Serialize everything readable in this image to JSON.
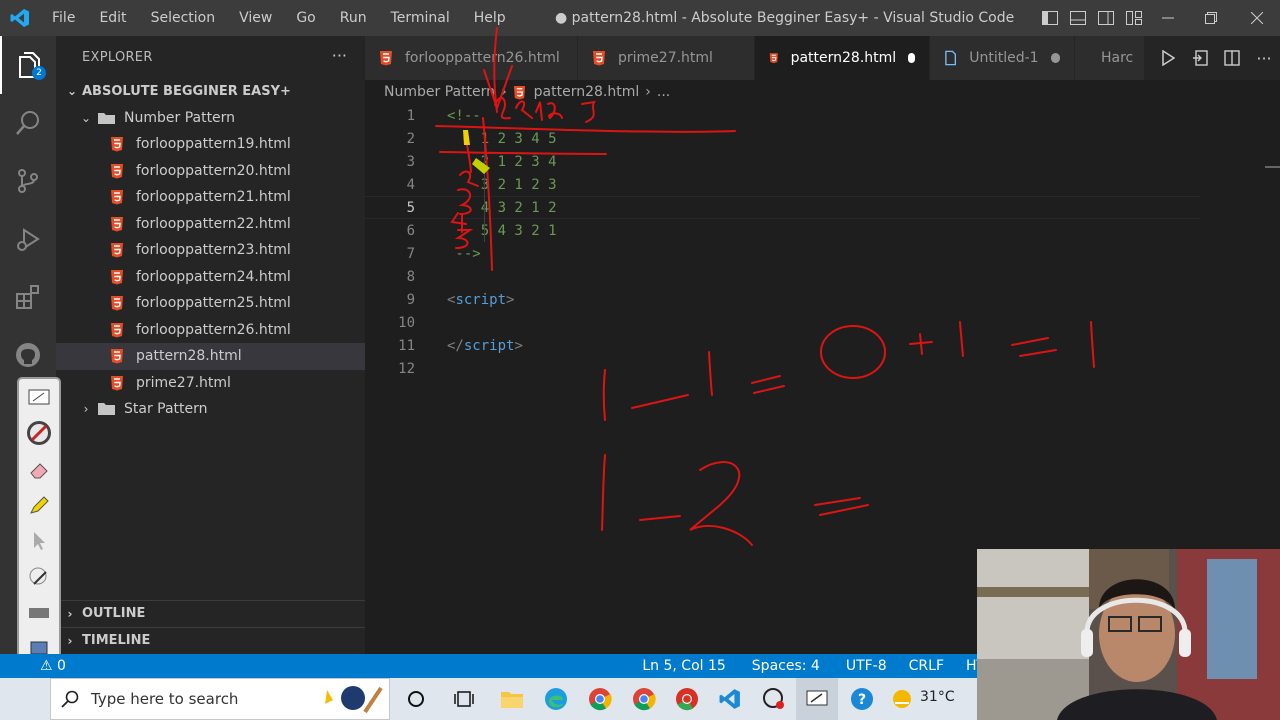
{
  "window": {
    "title": "● pattern28.html - Absolute Begginer Easy+ - Visual Studio Code",
    "menu": [
      "File",
      "Edit",
      "Selection",
      "View",
      "Go",
      "Run",
      "Terminal",
      "Help"
    ]
  },
  "activity_bar": {
    "explorer_badge": "2"
  },
  "sidebar": {
    "header": "EXPLORER",
    "root_folder": "ABSOLUTE BEGGINER EASY+",
    "folder_number_pattern": "Number Pattern",
    "files": [
      "forlooppattern19.html",
      "forlooppattern20.html",
      "forlooppattern21.html",
      "forlooppattern22.html",
      "forlooppattern23.html",
      "forlooppattern24.html",
      "forlooppattern25.html",
      "forlooppattern26.html",
      "pattern28.html",
      "prime27.html"
    ],
    "selected_file": "pattern28.html",
    "folder_star_pattern": "Star Pattern",
    "outline": "OUTLINE",
    "timeline": "TIMELINE"
  },
  "tabs": [
    {
      "label": "forlooppattern26.html",
      "active": false,
      "dirty": false
    },
    {
      "label": "prime27.html",
      "active": false,
      "dirty": false
    },
    {
      "label": "pattern28.html",
      "active": true,
      "dirty": true
    },
    {
      "label": "Untitled-1",
      "active": false,
      "dirty": true
    },
    {
      "label": "Harc",
      "active": false,
      "dirty": false
    }
  ],
  "breadcrumb": {
    "folder": "Number Pattern",
    "file": "pattern28.html",
    "tail": "..."
  },
  "editor": {
    "current_line": 5,
    "lines": [
      {
        "n": "1",
        "text": "<!--"
      },
      {
        "n": "2",
        "text": "    1 2 3 4 5"
      },
      {
        "n": "3",
        "text": "    2 1 2 3 4"
      },
      {
        "n": "4",
        "text": "    3 2 1 2 3"
      },
      {
        "n": "5",
        "text": "    4 3 2 1 2"
      },
      {
        "n": "6",
        "text": "    5 4 3 2 1"
      },
      {
        "n": "7",
        "text": " -->"
      },
      {
        "n": "8",
        "text": ""
      },
      {
        "n": "9",
        "text_open": "<",
        "tag": "script",
        "text_close": ">"
      },
      {
        "n": "10",
        "text": ""
      },
      {
        "n": "11",
        "text_open": "</",
        "tag": "script",
        "text_close": ">"
      },
      {
        "n": "12",
        "text": ""
      }
    ]
  },
  "statusbar": {
    "problems": "⚠ 0",
    "cursor": "Ln 5, Col 15",
    "spaces": "Spaces: 4",
    "encoding": "UTF-8",
    "eol": "CRLF",
    "language": "HT"
  },
  "taskbar": {
    "search_placeholder": "Type here to search",
    "temperature": "31°C"
  },
  "colors": {
    "accent": "#007acc",
    "html_icon": "#e44d26",
    "ink": "#e01010"
  }
}
